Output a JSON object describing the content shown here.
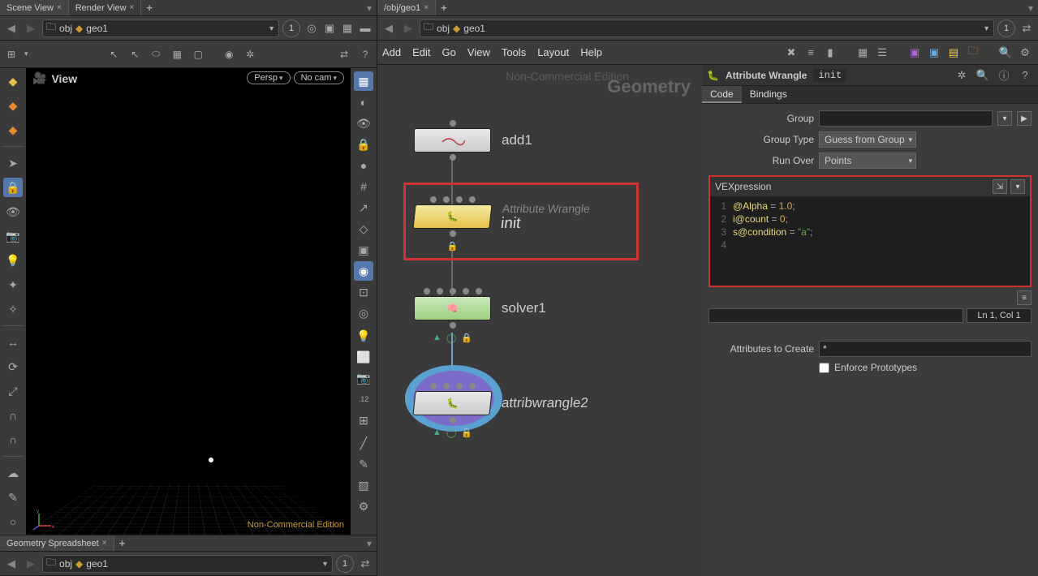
{
  "left": {
    "tabs": [
      "Scene View",
      "Render View"
    ],
    "path": {
      "obj": "obj",
      "geo": "geo1"
    },
    "pin": "1",
    "view_label": "View",
    "persp": "Persp",
    "nocam": "No cam",
    "watermark": "Non-Commercial Edition"
  },
  "right": {
    "path_tab": "/obj/geo1",
    "path": {
      "obj": "obj",
      "geo": "geo1"
    },
    "pin": "1",
    "menus": [
      "Add",
      "Edit",
      "Go",
      "View",
      "Tools",
      "Layout",
      "Help"
    ],
    "nce": "Non-Commercial Edition",
    "geo_watermark": "Geometry",
    "nodes": {
      "add1": {
        "label": "add1"
      },
      "init": {
        "type": "Attribute Wrangle",
        "label": "init"
      },
      "solver1": {
        "label": "solver1"
      },
      "aw2": {
        "label": "attribwrangle2"
      }
    }
  },
  "param": {
    "type": "Attribute Wrangle",
    "name": "init",
    "tabs": [
      "Code",
      "Bindings"
    ],
    "group_label": "Group",
    "group_type_label": "Group Type",
    "group_type_value": "Guess from Group",
    "run_over_label": "Run Over",
    "run_over_value": "Points",
    "vex_label": "VEXpression",
    "code": [
      {
        "raw": "@Alpha = 1.0;"
      },
      {
        "raw": "i@count = 0;"
      },
      {
        "raw": "s@condition = \"a\";"
      },
      {
        "raw": ""
      }
    ],
    "cursor": "Ln 1, Col 1",
    "attr_create_label": "Attributes to Create",
    "attr_create_value": "*",
    "enforce_label": "Enforce Prototypes"
  },
  "bottom": {
    "tab": "Geometry Spreadsheet",
    "path": {
      "obj": "obj",
      "geo": "geo1"
    },
    "pin": "1"
  }
}
